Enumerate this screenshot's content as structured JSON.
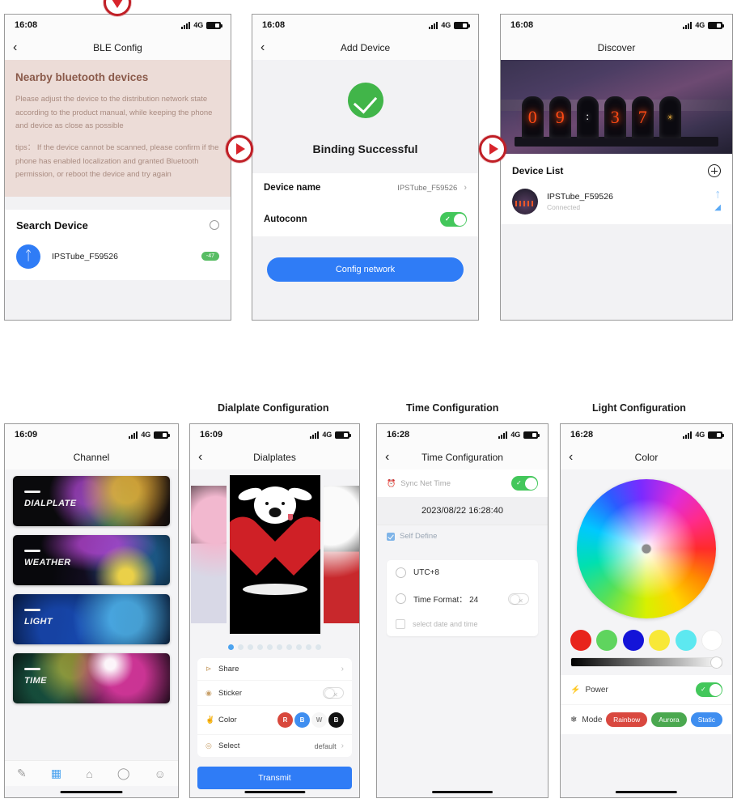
{
  "panels": {
    "ble_config": {
      "status": {
        "time": "16:08",
        "network": "4G"
      },
      "title": "BLE Config",
      "notice_heading": "Nearby bluetooth devices",
      "notice_p1": "Please adjust the device to the distribution network state according to the product manual, while keeping the phone and device as close as possible",
      "notice_p2": "tips： If the device cannot be scanned, please confirm if the phone has enabled localization and granted Bluetooth permission, or reboot the device and try again",
      "search_label": "Search Device",
      "device_name": "IPSTube_F59526",
      "rssi": "-47"
    },
    "add_device": {
      "status": {
        "time": "16:08",
        "network": "4G"
      },
      "title": "Add Device",
      "result_text": "Binding Successful",
      "device_name_label": "Device name",
      "device_name_value": "IPSTube_F59526",
      "autoconn_label": "Autoconn",
      "config_button": "Config network"
    },
    "discover": {
      "status": {
        "time": "16:08",
        "network": "4G"
      },
      "title": "Discover",
      "tubes": [
        "0",
        "9",
        ":",
        "3",
        "7",
        "☀"
      ],
      "list_title": "Device List",
      "device_name": "IPSTube_F59526",
      "device_status": "Connected"
    },
    "channel": {
      "status": {
        "time": "16:09",
        "network": "4G"
      },
      "title": "Channel",
      "cards": [
        {
          "name": "DIALPLATE"
        },
        {
          "name": "WEATHER"
        },
        {
          "name": "LIGHT"
        },
        {
          "name": "TIME"
        }
      ],
      "tabs": [
        "edit-icon",
        "grid-icon",
        "home-icon",
        "chat-icon",
        "profile-icon"
      ]
    },
    "dialplates": {
      "status": {
        "time": "16:09",
        "network": "4G"
      },
      "title": "Dialplates",
      "dot_count": 10,
      "active_dot": 0,
      "options": [
        {
          "icon": "share-icon",
          "label": "Share",
          "value": "",
          "chevron": "›"
        },
        {
          "icon": "sticker-icon",
          "label": "Sticker",
          "value": "",
          "chevron": ""
        },
        {
          "icon": "color-icon",
          "label": "Color",
          "value": "",
          "chevron": ""
        },
        {
          "icon": "select-icon",
          "label": "Select",
          "value": "default",
          "chevron": "›"
        }
      ],
      "color_chips": [
        "R",
        "B",
        "W",
        "B"
      ],
      "transmit_button": "Transmit"
    },
    "time_config": {
      "status": {
        "time": "16:28",
        "network": "4G"
      },
      "title": "Time Configuration",
      "sync_label": "Sync Net Time",
      "datetime": "2023/08/22 16:28:40",
      "self_define_label": "Self Define",
      "utc_label": "UTC+8",
      "time_format_label": "Time Format： 24",
      "select_date_label": "select date and time"
    },
    "color_config": {
      "status": {
        "time": "16:28",
        "network": "4G"
      },
      "title": "Color",
      "swatches": [
        "#e8241c",
        "#5fd45e",
        "#1414d8",
        "#f8e838",
        "#5de8f0",
        "#ffffff"
      ],
      "power_label": "Power",
      "mode_label": "Mode",
      "modes": [
        "Rainbow",
        "Aurora",
        "Static"
      ]
    }
  },
  "captions": {
    "dialplate": "Dialplate Configuration",
    "time": "Time Configuration",
    "light": "Light Configuration"
  },
  "markers": {
    "down": "play-down-marker",
    "right": "play-right-marker"
  }
}
